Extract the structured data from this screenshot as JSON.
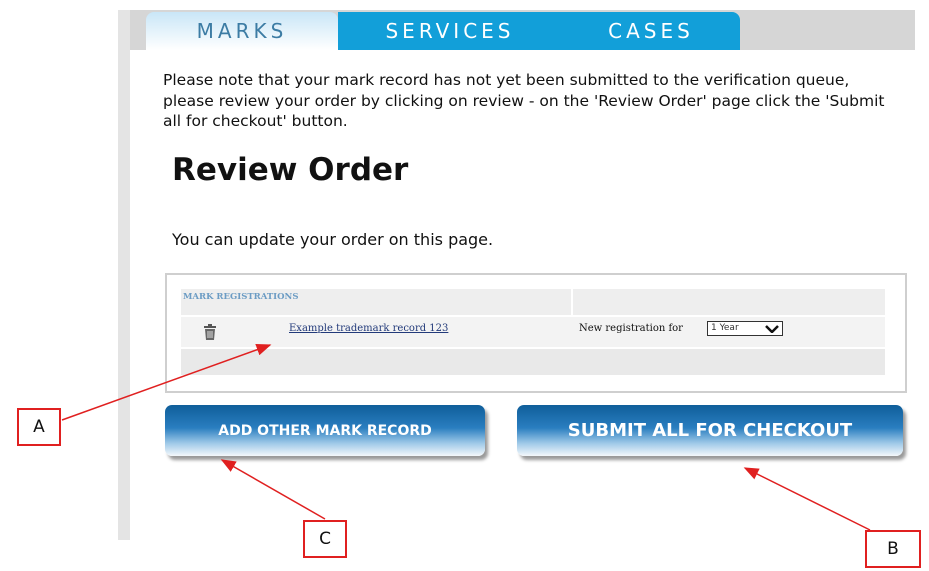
{
  "tabs": [
    {
      "label": "MARKS"
    },
    {
      "label": "SERVICES"
    },
    {
      "label": "CASES"
    }
  ],
  "notice": "Please note that your mark record has not yet been submitted to the verification queue, please review your order by clicking on review - on the 'Review Order' page click the 'Submit all for checkout' button.",
  "page_title": "Review Order",
  "subtitle": "You can update your order on this page.",
  "order": {
    "section_header": "MARK REGISTRATIONS",
    "record_link": "Example trademark record 123",
    "registration_label": "New registration for",
    "term_select": {
      "value": "1 Year"
    }
  },
  "buttons": {
    "add_other": "ADD OTHER MARK RECORD",
    "submit_all": "SUBMIT ALL FOR CHECKOUT"
  },
  "callouts": {
    "a": "A",
    "b": "B",
    "c": "C"
  },
  "colors": {
    "tab_active": "#129fd9",
    "callout_border": "#e02020",
    "button_dark": "#0f5e9a"
  }
}
